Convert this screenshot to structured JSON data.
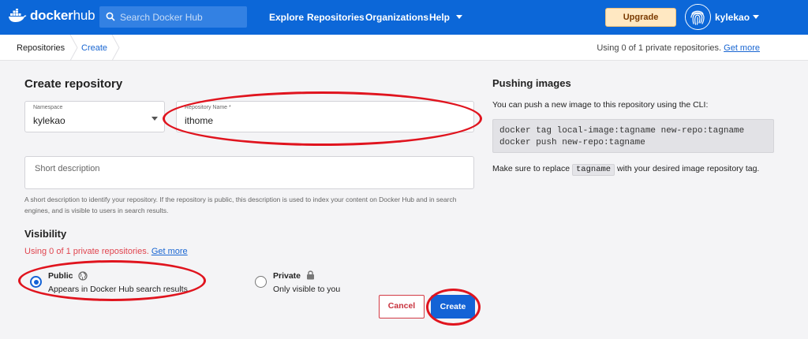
{
  "brand": {
    "name_docker": "docker",
    "name_hub": "hub"
  },
  "search": {
    "placeholder": "Search Docker Hub"
  },
  "nav": {
    "explore": "Explore",
    "repositories": "Repositories",
    "organizations": "Organizations",
    "help": "Help"
  },
  "header": {
    "upgrade": "Upgrade",
    "username": "kylekao"
  },
  "breadcrumb": {
    "repositories": "Repositories",
    "create": "Create"
  },
  "private_repo_note": {
    "text": "Using 0 of 1 private repositories.",
    "link": "Get more"
  },
  "form": {
    "title": "Create repository",
    "namespace": {
      "label": "Namespace",
      "value": "kylekao"
    },
    "repo_name": {
      "label": "Repository Name *",
      "value": "ithome"
    },
    "short_description": {
      "placeholder": "Short description"
    },
    "help_text": "A short description to identify your repository. If the repository is public, this description is used to index your content on Docker Hub and in search engines, and is visible to users in search results."
  },
  "visibility": {
    "title": "Visibility",
    "warning": "Using 0 of 1 private repositories.",
    "warning_link": "Get more",
    "public": {
      "title": "Public",
      "desc": "Appears in Docker Hub search results",
      "selected": true
    },
    "private": {
      "title": "Private",
      "desc": "Only visible to you",
      "selected": false
    }
  },
  "actions": {
    "cancel": "Cancel",
    "create": "Create"
  },
  "pushing": {
    "title": "Pushing images",
    "intro": "You can push a new image to this repository using the CLI:",
    "code_line1": "docker tag local-image:tagname new-repo:tagname",
    "code_line2": "docker push new-repo:tagname",
    "replace_before": "Make sure to replace",
    "replace_chip": "tagname",
    "replace_after": "with your desired image repository tag."
  },
  "colors": {
    "brand_blue": "#0c67d8",
    "primary_button": "#1463d6",
    "danger": "#e0454f",
    "highlight_ring": "#e0141e"
  },
  "icons": [
    "docker-whale-icon",
    "search-icon",
    "chevron-down-icon",
    "fingerprint-avatar-icon",
    "globe-icon",
    "lock-icon"
  ]
}
